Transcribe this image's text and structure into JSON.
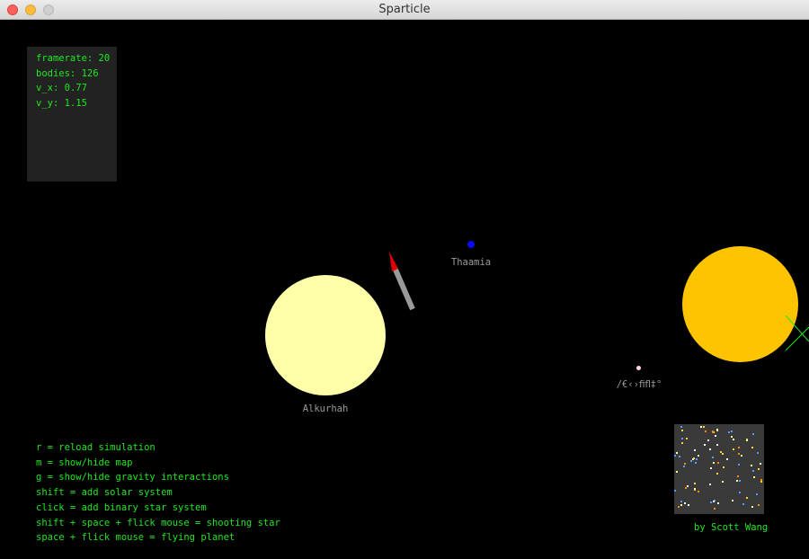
{
  "window": {
    "title": "Sparticle",
    "close_color": "#fc605b",
    "minimize_color": "#fdbc40",
    "zoom_color": "#cfcfcf"
  },
  "stats": [
    {
      "key": "framerate",
      "text": "framerate: 20"
    },
    {
      "key": "bodies",
      "text": "bodies: 126"
    },
    {
      "key": "v_x",
      "text": "v_x: 0.77"
    },
    {
      "key": "v_y",
      "text": "v_y: 1.15"
    }
  ],
  "bodies": [
    {
      "name": "Alkurhah",
      "type": "star",
      "color": "#ffffaa"
    },
    {
      "name": "Thaamia",
      "type": "planet",
      "color": "#0a0aff"
    },
    {
      "name": "/€‹›ﬁﬂ‡°",
      "type": "planet",
      "color": "#ffd6e0"
    },
    {
      "name": "",
      "type": "star",
      "color": "#ffc400"
    }
  ],
  "ship": {
    "type": "flying-planet-rocket",
    "body_color": "#9a9a9a",
    "nose_color": "#e00000"
  },
  "gravity_line_color": "#1ee81e",
  "help": [
    "r = reload simulation",
    "m = show/hide map",
    "g = show/hide gravity interactions",
    "shift = add solar system",
    "click = add binary star system",
    "shift + space + flick mouse = shooting star",
    "space + flick mouse = flying planet"
  ],
  "minimap": {
    "background": "#3a3a3a",
    "dot_colors": [
      "#ffd23c",
      "#ffffaa",
      "#5a9cff",
      "#ffffff",
      "#ff8a00"
    ]
  },
  "credit": "by Scott Wang"
}
